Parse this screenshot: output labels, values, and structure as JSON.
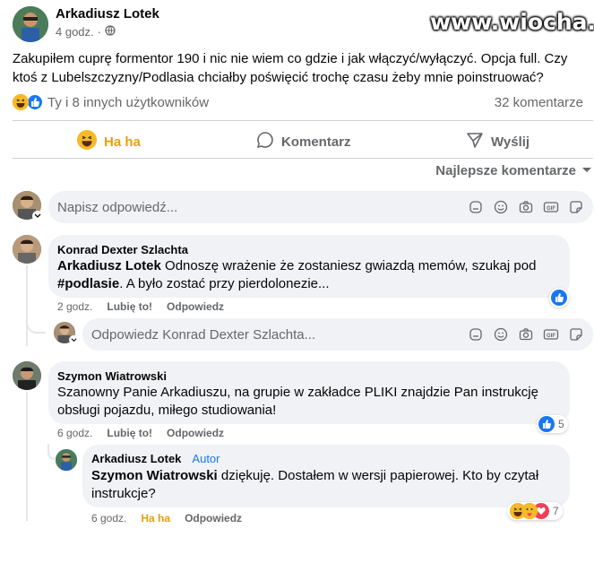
{
  "post": {
    "author": "Arkadiusz Lotek",
    "time": "4 godz.",
    "separator": "·",
    "watermark": "www.wiocha.pl",
    "text": "Zakupiłem cuprę formentor 190 i nic nie wiem co gdzie i jak włączyć/wyłączyć. Opcja full. Czy ktoś z Lubelszczyzny/Podlasia chciałby poświęcić trochę czasu żeby mnie poinstruować?",
    "reactions_text": "Ty i 8 innych użytkowników",
    "comments_count": "32 komentarze"
  },
  "actions": {
    "haha": "Ha ha",
    "comment": "Komentarz",
    "send": "Wyślij"
  },
  "sort_label": "Najlepsze komentarze",
  "reply_input": {
    "placeholder": "Napisz odpowiedź..."
  },
  "comments": [
    {
      "author": "Konrad Dexter Szlachta",
      "mention": "Arkadiusz Lotek",
      "text_1": " Odnoszę wrażenie że zostaniesz gwiazdą memów, szukaj pod",
      "hashtag": "#podlasie",
      "text_2": ". A było zostać przy pierdolonezie...",
      "time": "2 godz.",
      "like": "Lubię to!",
      "reply": "Odpowiedz",
      "reply_placeholder": "Odpowiedz Konrad Dexter Szlachta..."
    },
    {
      "author": "Szymon Wiatrowski",
      "text": "Szanowny Panie Arkadiuszu, na grupie w zakładce PLIKI znajdzie Pan instrukcję obsługi pojazdu, miłego studiowania!",
      "time": "6 godz.",
      "like": "Lubię to!",
      "reply": "Odpowiedz",
      "reaction_count": "5"
    }
  ],
  "nested_reply": {
    "author": "Arkadiusz Lotek",
    "author_badge": "Autor",
    "mention": "Szymon Wiatrowski",
    "text": " dziękuję. Dostałem w wersji papierowej. Kto by czytał instrukcje?",
    "time": "6 godz.",
    "haha": "Ha ha",
    "reply": "Odpowiedz",
    "reaction_count": "7"
  },
  "colors": {
    "fb_blue": "#1877f2",
    "haha_yellow": "#f7b928",
    "grey_text": "#65676b",
    "bubble_bg": "#f0f2f5",
    "watermark": "#ffffff"
  }
}
